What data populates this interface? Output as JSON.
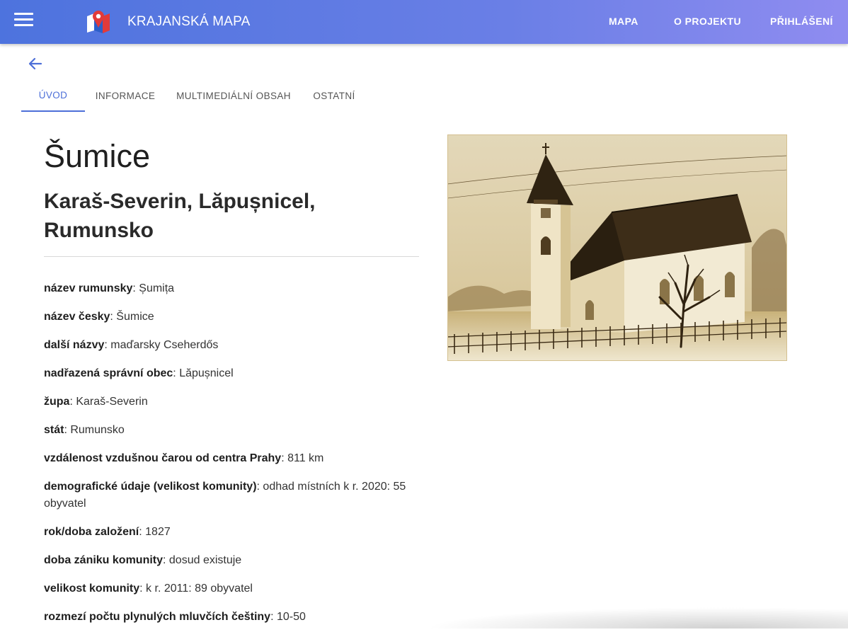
{
  "appbar": {
    "brand": "KRAJANSKÁ MAPA",
    "nav": [
      "MAPA",
      "O PROJEKTU",
      "PŘIHLÁŠENÍ"
    ]
  },
  "tabs": [
    "ÚVOD",
    "INFORMACE",
    "MULTIMEDIÁLNÍ OBSAH",
    "OSTATNÍ"
  ],
  "active_tab": "ÚVOD",
  "place": {
    "title": "Šumice",
    "subtitle": "Karaš-Severin, Lăpușnicel, Rumunsko"
  },
  "facts": [
    {
      "label": "název rumunsky",
      "value": ": Șumița"
    },
    {
      "label": "název česky",
      "value": ": Šumice"
    },
    {
      "label": "další názvy",
      "value": ": maďarsky Cseherdős"
    },
    {
      "label": "nadřazená správní obec",
      "value": ": Lăpușnicel"
    },
    {
      "label": "župa",
      "value": ": Karaš-Severin"
    },
    {
      "label": "stát",
      "value": ": Rumunsko"
    },
    {
      "label": "vzdálenost vzdušnou čarou od centra Prahy",
      "value": ": 811 km"
    },
    {
      "label": "demografické údaje (velikost komunity)",
      "value": ": odhad místních k r. 2020: 55 obyvatel"
    },
    {
      "label": "rok/doba založení",
      "value": ": 1827"
    },
    {
      "label": "doba zániku komunity",
      "value": ": dosud existuje"
    },
    {
      "label": "velikost komunity",
      "value": ": k r. 2011: 89 obyvatel"
    },
    {
      "label": "rozmezí počtu plynulých mluvčích češtiny",
      "value": ": 10-50"
    }
  ],
  "icons": {
    "menu": "menu-icon",
    "back": "arrow-back-icon",
    "logo": "krajanska-mapa-logo"
  },
  "colors": {
    "appbar_start": "#4d73de",
    "appbar_end": "#8f8cf0",
    "accent": "#4d6fd8"
  }
}
